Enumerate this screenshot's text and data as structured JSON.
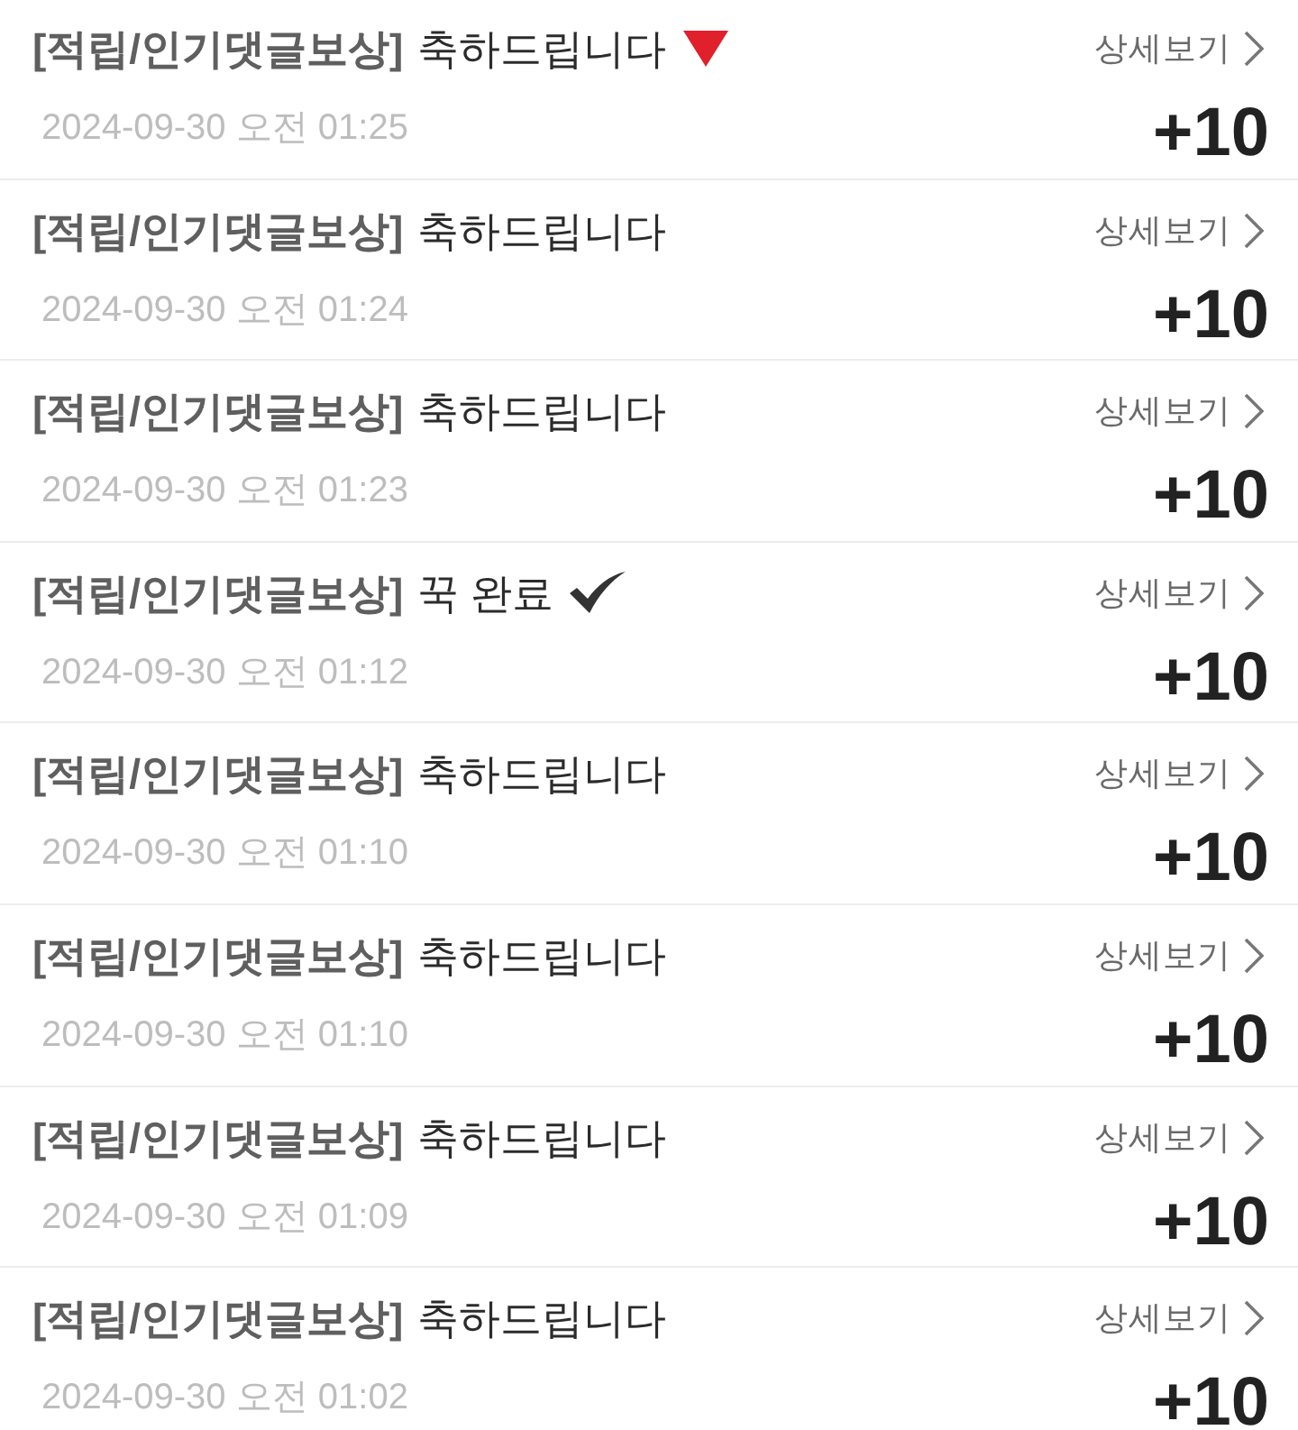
{
  "items": [
    {
      "kind": "triangle",
      "tag": "[적립/인기댓글보상]",
      "title": "축하드립니다",
      "detail": "상세보기",
      "date": "2024-09-30 오전 01:25",
      "points": "+10"
    },
    {
      "kind": "plain",
      "tag": "[적립/인기댓글보상]",
      "title": "축하드립니다",
      "detail": "상세보기",
      "date": "2024-09-30 오전 01:24",
      "points": "+10"
    },
    {
      "kind": "plain",
      "tag": "[적립/인기댓글보상]",
      "title": "축하드립니다",
      "detail": "상세보기",
      "date": "2024-09-30 오전 01:23",
      "points": "+10"
    },
    {
      "kind": "check",
      "tag": "[적립/인기댓글보상]",
      "title": "꾹 완료",
      "detail": "상세보기",
      "date": "2024-09-30 오전 01:12",
      "points": "+10"
    },
    {
      "kind": "plain",
      "tag": "[적립/인기댓글보상]",
      "title": "축하드립니다",
      "detail": "상세보기",
      "date": "2024-09-30 오전 01:10",
      "points": "+10"
    },
    {
      "kind": "plain",
      "tag": "[적립/인기댓글보상]",
      "title": "축하드립니다",
      "detail": "상세보기",
      "date": "2024-09-30 오전 01:10",
      "points": "+10"
    },
    {
      "kind": "plain",
      "tag": "[적립/인기댓글보상]",
      "title": "축하드립니다",
      "detail": "상세보기",
      "date": "2024-09-30 오전 01:09",
      "points": "+10"
    },
    {
      "kind": "plain",
      "tag": "[적립/인기댓글보상]",
      "title": "축하드립니다",
      "detail": "상세보기",
      "date": "2024-09-30 오전 01:02",
      "points": "+10"
    }
  ]
}
